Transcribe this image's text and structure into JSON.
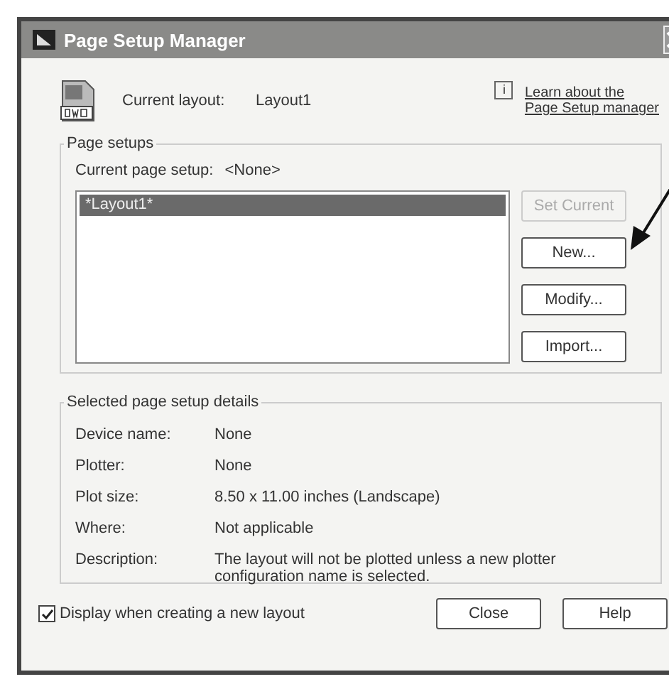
{
  "window": {
    "title": "Page Setup Manager"
  },
  "current_layout": {
    "label": "Current layout:",
    "value": "Layout1"
  },
  "help_link": {
    "icon": "i",
    "lines": [
      "Learn about the",
      "Page Setup manager"
    ]
  },
  "page_setups": {
    "title": "Page setups",
    "current_label": "Current page setup:",
    "current_value": "<None>",
    "items": [
      {
        "label": "*Layout1*",
        "selected": true
      }
    ],
    "buttons": [
      {
        "label": "Set Current",
        "disabled": true
      },
      {
        "label": "New...",
        "disabled": false
      },
      {
        "label": "Modify...",
        "disabled": false
      },
      {
        "label": "Import...",
        "disabled": false
      }
    ]
  },
  "details": {
    "title": "Selected page setup details",
    "rows": [
      {
        "label": "Device name:",
        "value": "None"
      },
      {
        "label": "Plotter:",
        "value": "None"
      },
      {
        "label": "Plot size:",
        "value": "8.50 x 11.00 inches (Landscape)"
      },
      {
        "label": "Where:",
        "value": "Not applicable"
      },
      {
        "label": "Description:",
        "value": "The layout will not be plotted unless a new plotter configuration name is selected."
      }
    ]
  },
  "display_option": {
    "label": "Display when creating a new layout",
    "checked": true
  },
  "footer_buttons": [
    "Close",
    "Help"
  ]
}
